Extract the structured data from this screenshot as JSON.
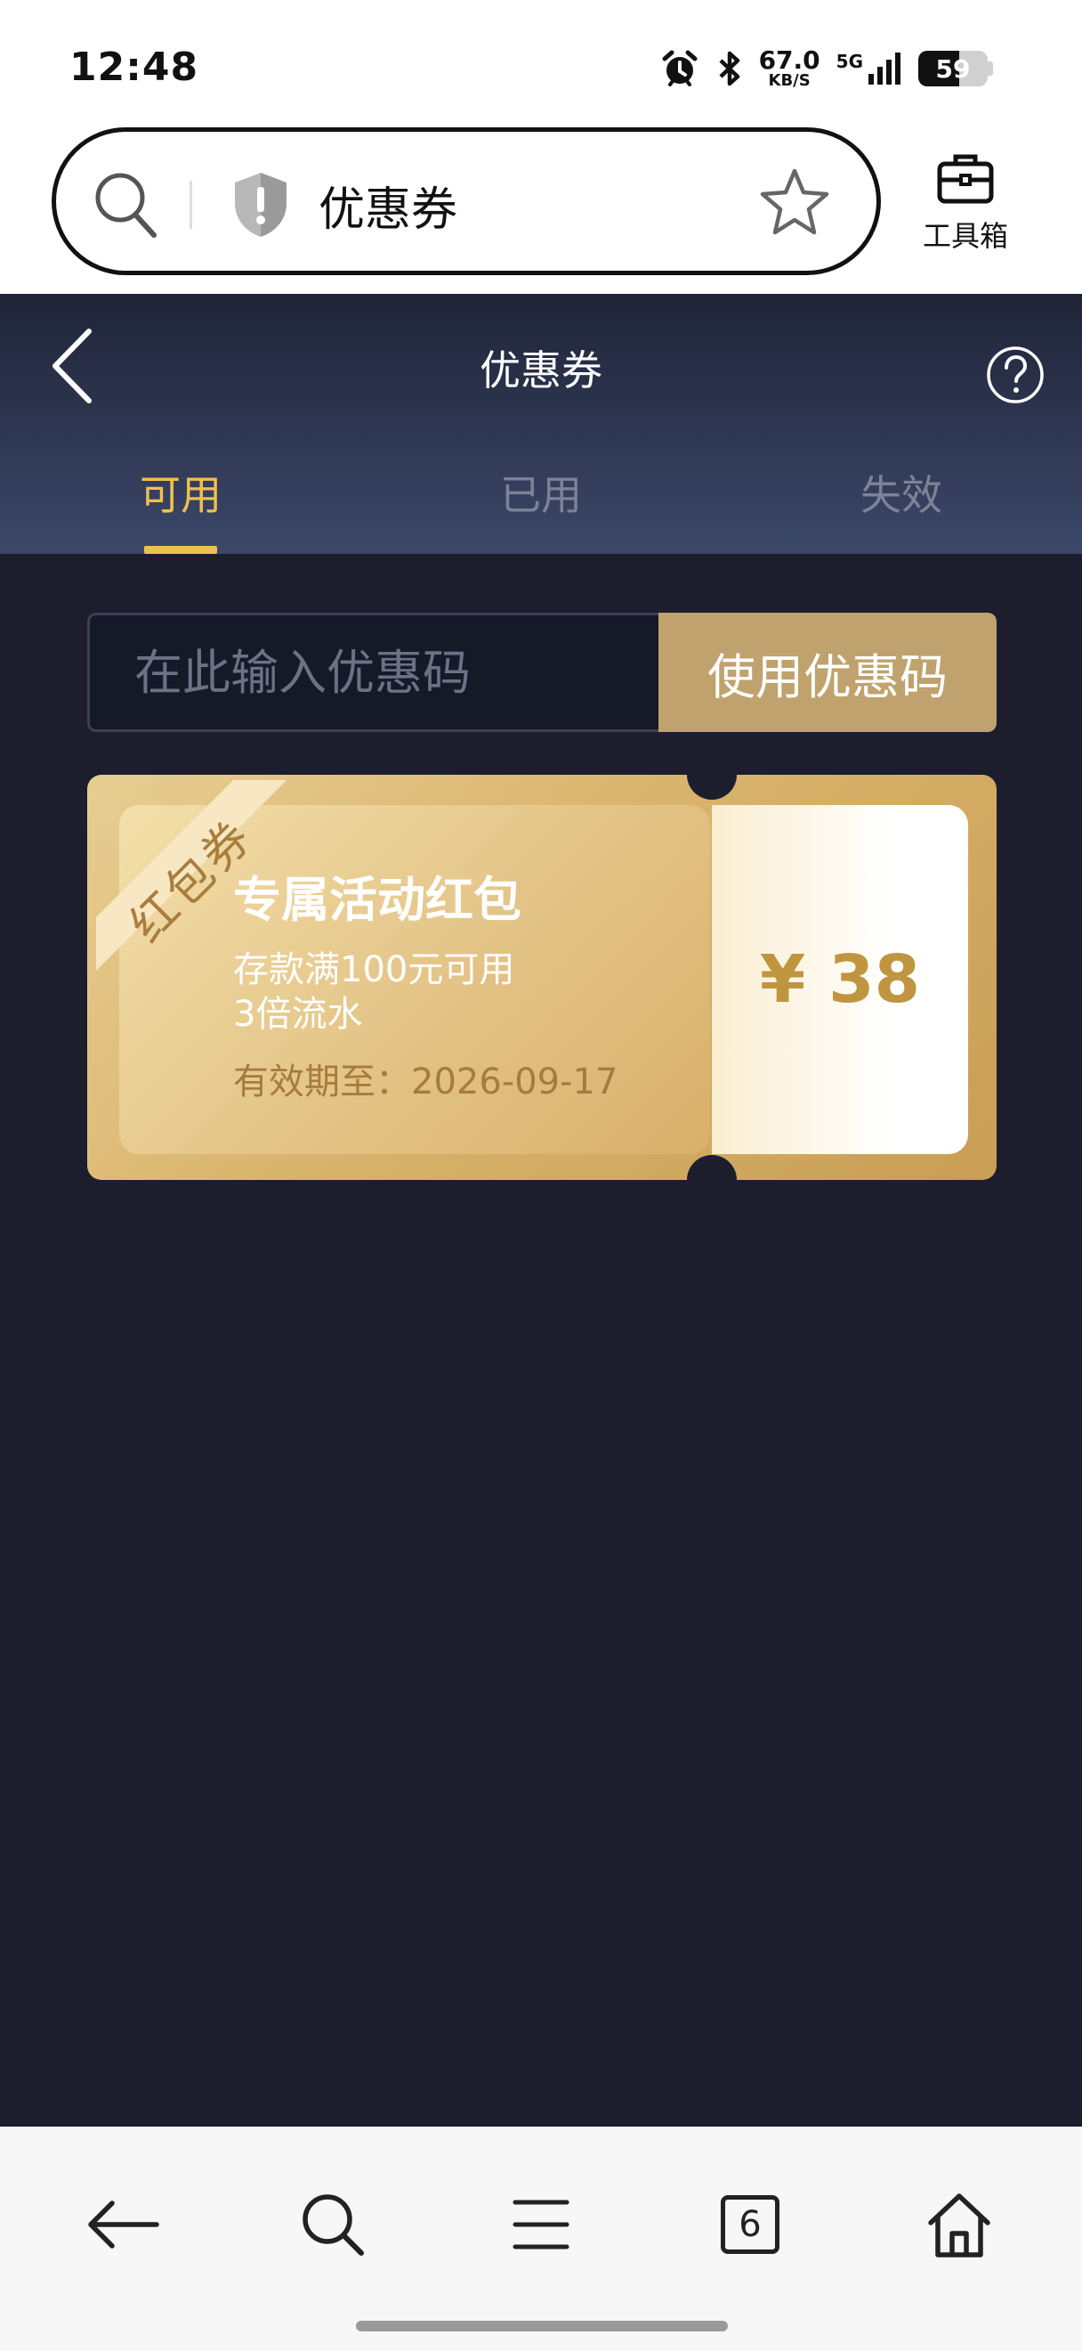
{
  "status_bar": {
    "time": "12:48",
    "net_speed": "67.0",
    "net_unit": "KB/S",
    "network": "5G",
    "battery": "59",
    "battery_level": 0.59,
    "icons": [
      "alarm-icon",
      "bluetooth-icon",
      "signal-icon",
      "battery-icon"
    ]
  },
  "browser": {
    "url_text": "优惠券",
    "toolbox_label": "工具箱",
    "icons": [
      "search-icon",
      "shield-warning-icon",
      "star-icon",
      "toolbox-icon"
    ]
  },
  "header": {
    "title": "优惠券",
    "icons": [
      "back-icon",
      "help-icon"
    ]
  },
  "tabs": [
    {
      "label": "可用",
      "active": true
    },
    {
      "label": "已用",
      "active": false
    },
    {
      "label": "失效",
      "active": false
    }
  ],
  "coupon_code": {
    "placeholder": "在此输入优惠码",
    "value": "",
    "button_label": "使用优惠码"
  },
  "coupons": [
    {
      "ribbon": "红包券",
      "title": "专属活动红包",
      "desc_line1": "存款满100元可用",
      "desc_line2": "3倍流水",
      "expiry": "有效期至：2026-09-17",
      "amount": "¥ 38"
    }
  ],
  "bottom_nav": {
    "tab_count": "6",
    "icons": [
      "back-arrow-icon",
      "search-icon",
      "menu-icon",
      "tabs-icon",
      "home-icon"
    ]
  },
  "colors": {
    "page_bg": "#1c1e2d",
    "accent_gold": "#f0c04f",
    "button_gold": "#bfa26d",
    "amount_gold": "#bf953f"
  }
}
